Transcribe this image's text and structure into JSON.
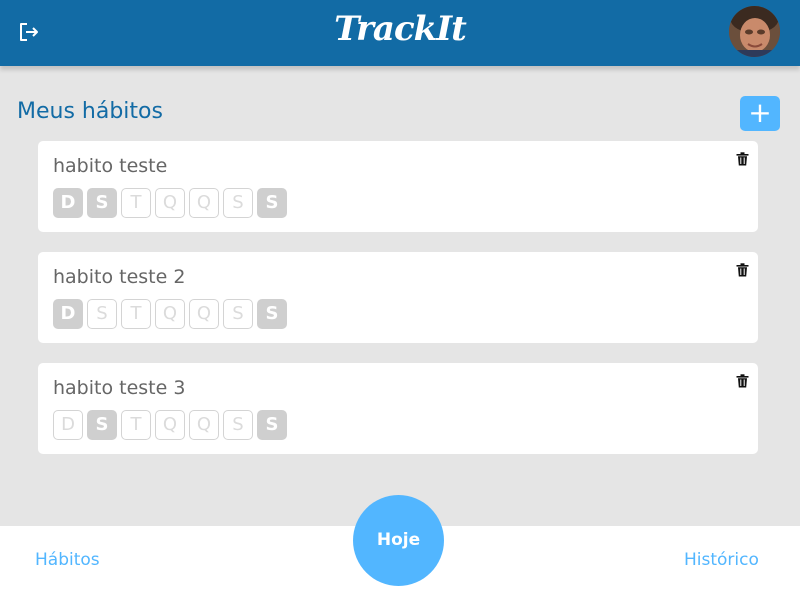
{
  "header": {
    "logo": "TrackIt",
    "icons": {
      "logout": "logout-icon",
      "avatar": "user-avatar-photo"
    },
    "background_color": "#126ba5"
  },
  "main": {
    "title": "Meus hábitos",
    "add_button_label": "+",
    "accent_color": "#52b6ff",
    "habits": [
      {
        "name": "habito teste",
        "days": [
          {
            "label": "D",
            "selected": true
          },
          {
            "label": "S",
            "selected": true
          },
          {
            "label": "T",
            "selected": false
          },
          {
            "label": "Q",
            "selected": false
          },
          {
            "label": "Q",
            "selected": false
          },
          {
            "label": "S",
            "selected": false
          },
          {
            "label": "S",
            "selected": true
          }
        ]
      },
      {
        "name": "habito teste 2",
        "days": [
          {
            "label": "D",
            "selected": true
          },
          {
            "label": "S",
            "selected": false
          },
          {
            "label": "T",
            "selected": false
          },
          {
            "label": "Q",
            "selected": false
          },
          {
            "label": "Q",
            "selected": false
          },
          {
            "label": "S",
            "selected": false
          },
          {
            "label": "S",
            "selected": true
          }
        ]
      },
      {
        "name": "habito teste 3",
        "days": [
          {
            "label": "D",
            "selected": false
          },
          {
            "label": "S",
            "selected": true
          },
          {
            "label": "T",
            "selected": false
          },
          {
            "label": "Q",
            "selected": false
          },
          {
            "label": "Q",
            "selected": false
          },
          {
            "label": "S",
            "selected": false
          },
          {
            "label": "S",
            "selected": true
          }
        ]
      }
    ]
  },
  "footer": {
    "habits_link": "Hábitos",
    "today_button": "Hoje",
    "history_link": "Histórico"
  }
}
